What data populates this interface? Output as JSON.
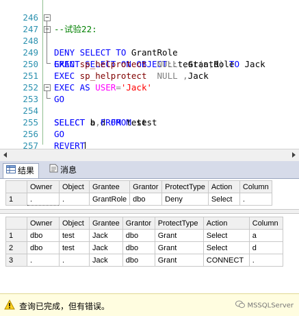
{
  "editor": {
    "lines": [
      {
        "num": "246",
        "text": "--试验22:"
      },
      {
        "num": "247",
        "text": "DENY SELECT TO GrantRole"
      },
      {
        "num": "248",
        "text": "GRANT SELECT ON OBJECT::test(a,d) TO Jack"
      },
      {
        "num": "249",
        "text": "EXEC sp_helprotect  NULL ,GrantRole"
      },
      {
        "num": "250",
        "text": "EXEC sp_helprotect  NULL ,Jack"
      },
      {
        "num": "251",
        "text": "EXEC AS USER='Jack'"
      },
      {
        "num": "252",
        "text": "GO"
      },
      {
        "num": "253",
        "text": "SELECT a,d FROM test"
      },
      {
        "num": "254",
        "text": "SELECT b FROM test"
      },
      {
        "num": "255",
        "text": "GO"
      },
      {
        "num": "256",
        "text": "REVERT"
      },
      {
        "num": "257",
        "text": "GO"
      }
    ],
    "tokens": {
      "l246": "--试验22:",
      "l247_a": "DENY SELECT TO ",
      "l247_b": "GrantRole",
      "l248_a": "GRANT SELECT ON OBJECT",
      "l248_b": "::",
      "l248_c": "test",
      "l248_d": "(",
      "l248_e": "a",
      "l248_f": ",",
      "l248_g": "d",
      "l248_h": ")",
      "l248_i": " TO ",
      "l248_j": "Jack",
      "l249_a": "EXEC ",
      "l249_b": "sp_helprotect",
      "l249_c": "  NULL ",
      "l249_d": ",",
      "l249_e": "GrantRole",
      "l250_a": "EXEC ",
      "l250_b": "sp_helprotect",
      "l250_c": "  NULL ",
      "l250_d": ",",
      "l250_e": "Jack",
      "l251_a": "EXEC AS ",
      "l251_b": "USER",
      "l251_c": "=",
      "l251_d": "'Jack'",
      "l252": "GO",
      "l253_a": "SELECT ",
      "l253_b": "a",
      "l253_c": ",",
      "l253_d": "d",
      "l253_e": " FROM ",
      "l253_f": "test",
      "l254_a": "SELECT ",
      "l254_b": "b",
      "l254_c": " FROM ",
      "l254_d": "test",
      "l255": "GO",
      "l256": "REVERT",
      "l257": "GO"
    }
  },
  "tabs": [
    {
      "label": "结果",
      "icon": "grid-icon"
    },
    {
      "label": "消息",
      "icon": "message-icon"
    }
  ],
  "grid1": {
    "columns": [
      "Owner",
      "Object",
      "Grantee",
      "Grantor",
      "ProtectType",
      "Action",
      "Column"
    ],
    "rows": [
      {
        "n": "1",
        "cells": [
          ".",
          ".",
          "GrantRole",
          "dbo",
          "Deny",
          "Select",
          "."
        ]
      }
    ]
  },
  "grid2": {
    "columns": [
      "Owner",
      "Object",
      "Grantee",
      "Grantor",
      "ProtectType",
      "Action",
      "Column"
    ],
    "rows": [
      {
        "n": "1",
        "cells": [
          "dbo",
          "test",
          "Jack",
          "dbo",
          "Grant",
          "Select",
          "a"
        ]
      },
      {
        "n": "2",
        "cells": [
          "dbo",
          "test",
          "Jack",
          "dbo",
          "Grant",
          "Select",
          "d"
        ]
      },
      {
        "n": "3",
        "cells": [
          ".",
          ".",
          "Jack",
          "dbo",
          "Grant",
          "CONNECT",
          "."
        ]
      }
    ]
  },
  "status": {
    "text": "查询已完成，但有错误。",
    "watermark": "MSSQLServer",
    "icon": "warning-icon"
  }
}
